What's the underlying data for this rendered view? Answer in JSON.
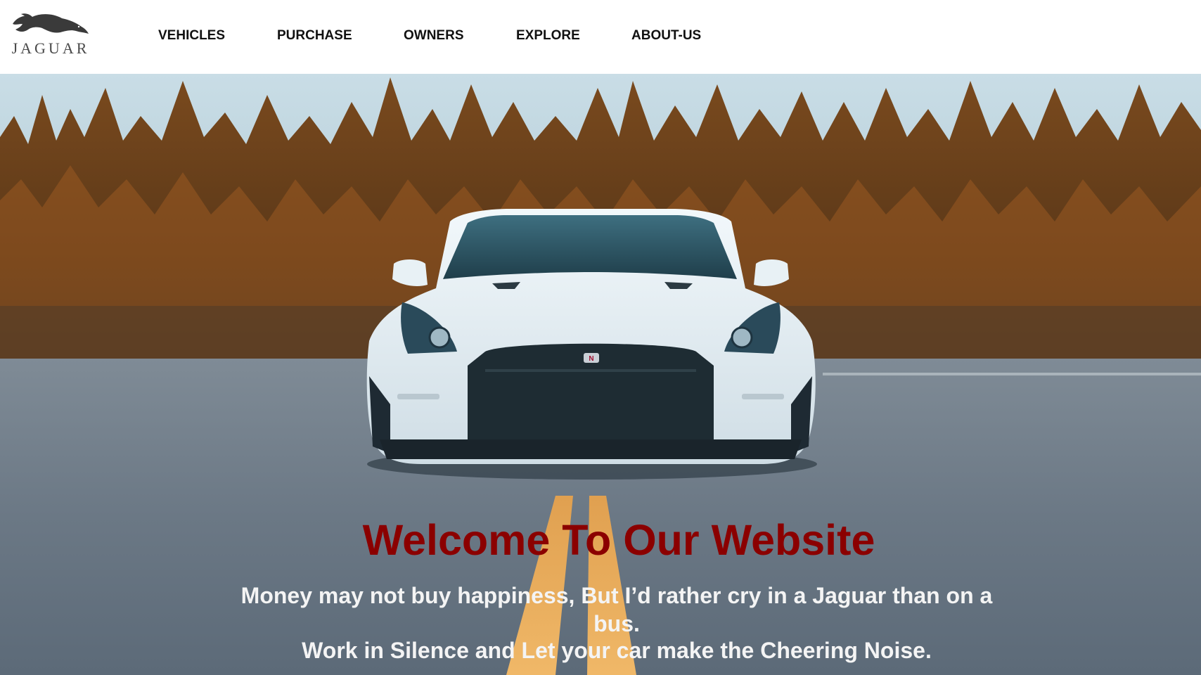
{
  "brand": {
    "name": "JAGUAR",
    "logo_icon": "leaping-jaguar-icon"
  },
  "nav": {
    "items": [
      {
        "label": "VEHICLES"
      },
      {
        "label": "PURCHASE"
      },
      {
        "label": "OWNERS"
      },
      {
        "label": "EXPLORE"
      },
      {
        "label": "ABOUT-US"
      }
    ]
  },
  "hero": {
    "image": "white-sports-car-on-road-with-autumn-forest",
    "headline": "Welcome To Our Website",
    "quote_line1": "Money may not buy happiness, But I’d rather cry in a Jaguar than on a",
    "quote_line1_wrap": "bus.",
    "quote_line2": "Work in Silence and Let your car make the Cheering Noise."
  },
  "colors": {
    "headline": "#8b0000",
    "quote": "#f4f4f4",
    "nav_text": "#111111",
    "navbar_bg": "#ffffff"
  }
}
